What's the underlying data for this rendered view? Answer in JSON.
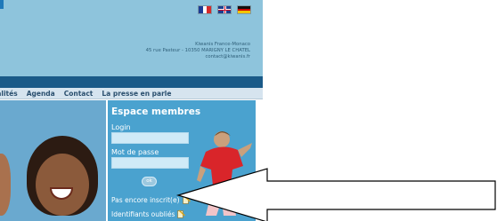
{
  "header": {
    "address_lines": [
      "Kiwanis France-Monaco",
      "45 rue Pasteur - 10350 MARIGNY LE CHATEL",
      "contact@kiwanis.fr"
    ]
  },
  "languages": [
    {
      "name": "french-flag-icon",
      "colors": [
        "#1b3c95",
        "#ffffff",
        "#d42a2a"
      ]
    },
    {
      "name": "uk-flag-icon"
    },
    {
      "name": "german-flag-icon",
      "colors": [
        "#111111",
        "#d00000",
        "#f2c400"
      ]
    }
  ],
  "nav": {
    "items": [
      "ualités",
      "Agenda",
      "Contact",
      "La presse en parle"
    ]
  },
  "members": {
    "title": "Espace membres",
    "login_label": "Login",
    "password_label": "Mot de passe",
    "ok_label": "ok",
    "register_link": "Pas encore inscrit(e)",
    "forgot_link": "Identifiants oubliés"
  },
  "colors": {
    "header_bg": "#8ec4dc",
    "nav_bar": "#1a5a88",
    "panel_bg": "#4aa2cf"
  }
}
